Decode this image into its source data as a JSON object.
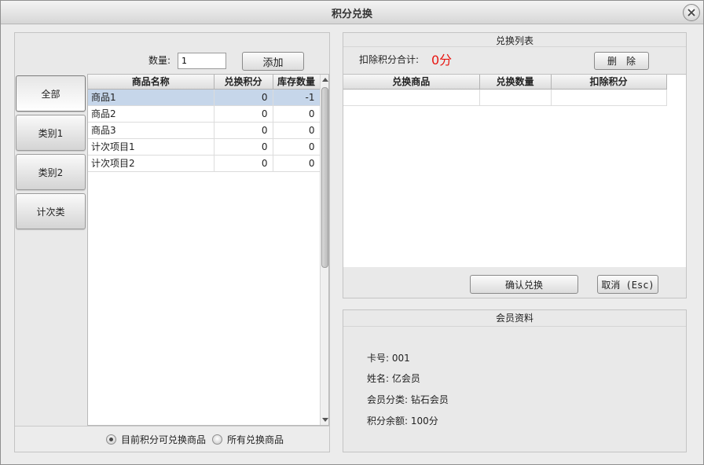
{
  "window": {
    "title": "积分兑换"
  },
  "left": {
    "quantity_label": "数量:",
    "quantity_value": "1",
    "add_label": "添加",
    "categories": [
      "全部",
      "类别1",
      "类别2",
      "计次类"
    ],
    "columns": [
      "商品名称",
      "兑换积分",
      "库存数量"
    ],
    "rows": [
      [
        "商品1",
        "0",
        "-1"
      ],
      [
        "商品2",
        "0",
        "0"
      ],
      [
        "商品3",
        "0",
        "0"
      ],
      [
        "计次项目1",
        "0",
        "0"
      ],
      [
        "计次项目2",
        "0",
        "0"
      ]
    ],
    "radio_current": "目前积分可兑换商品",
    "radio_all": "所有兑换商品"
  },
  "exchange": {
    "title": "兑换列表",
    "deduct_label": "扣除积分合计:",
    "deduct_total": "0分",
    "delete_label": "删　除",
    "columns": [
      "兑换商品",
      "兑换数量",
      "扣除积分"
    ],
    "confirm_label": "确认兑换",
    "cancel_label": "取消 (Esc)"
  },
  "member": {
    "title": "会员资料",
    "card": "卡号: 001",
    "name": "姓名: 亿会员",
    "category": "会员分类: 钻石会员",
    "balance": "积分余额: 100分"
  },
  "colors": {
    "selected_row": "#c6d6ea",
    "deduct_total": "#e8140f"
  },
  "icons": {
    "close": "close-icon",
    "scroll_up": "arrow-up-icon",
    "scroll_down": "arrow-down-icon"
  }
}
